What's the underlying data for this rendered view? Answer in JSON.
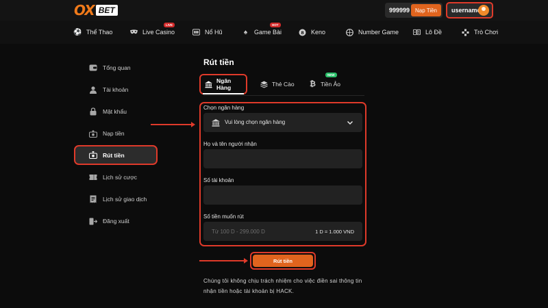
{
  "header": {
    "logo_main": "OX",
    "logo_sub": "BET",
    "balance": "999999 D",
    "deposit_label": "Nạp Tiền",
    "username": "username"
  },
  "nav": {
    "items": [
      {
        "label": "Thể Thao",
        "icon": "soccer-ball-icon",
        "badge": ""
      },
      {
        "label": "Live Casino",
        "icon": "mask-icon",
        "badge": "LIVE"
      },
      {
        "label": "Nổ Hũ",
        "icon": "slot-machine-icon",
        "badge": ""
      },
      {
        "label": "Game Bài",
        "icon": "spade-icon",
        "badge": "HOT"
      },
      {
        "label": "Keno",
        "icon": "keno-ball-icon",
        "badge": ""
      },
      {
        "label": "Number Game",
        "icon": "lottery-ball-icon",
        "badge": ""
      },
      {
        "label": "Lô Đề",
        "icon": "dice-icon",
        "badge": ""
      },
      {
        "label": "Trò Chơi",
        "icon": "gamepad-icon",
        "badge": ""
      }
    ]
  },
  "sidebar": {
    "items": [
      {
        "label": "Tổng quan",
        "icon": "dashboard-icon"
      },
      {
        "label": "Tài khoản",
        "icon": "user-icon"
      },
      {
        "label": "Mật khẩu",
        "icon": "lock-icon"
      },
      {
        "label": "Nạp tiền",
        "icon": "deposit-icon"
      },
      {
        "label": "Rút tiền",
        "icon": "withdraw-icon",
        "active": true
      },
      {
        "label": "Lịch sử cược",
        "icon": "ticket-icon"
      },
      {
        "label": "Lịch sử giao dịch",
        "icon": "receipt-icon"
      },
      {
        "label": "Đăng xuất",
        "icon": "logout-icon"
      }
    ]
  },
  "main": {
    "title": "Rút tiền",
    "tabs": [
      {
        "label": "Ngân Hàng",
        "icon": "bank-icon",
        "active": true
      },
      {
        "label": "Thẻ Cào",
        "icon": "card-stack-icon"
      },
      {
        "label": "Tiền Ảo",
        "icon": "bitcoin-icon",
        "badge": "NEW"
      }
    ],
    "form": {
      "bank_label": "Chọn ngân hàng",
      "bank_placeholder": "Vui lòng chọn ngân hàng",
      "name_label": "Họ và tên người nhận",
      "name_value": "",
      "account_label": "Số tài khoản",
      "account_value": "",
      "amount_label": "Số tiền muốn rút",
      "amount_placeholder": "Từ 100 D - 299.000 D",
      "rate": "1 D = 1.000 VND"
    },
    "submit_label": "Rút tiền",
    "notice": "Chúng tôi không chịu trách nhiệm cho việc điền sai thông tin nhận tiền hoặc tài khoản bị HACK."
  },
  "colors": {
    "accent": "#e0641e",
    "highlight": "#e03a2a",
    "background": "#0c0c0c"
  }
}
